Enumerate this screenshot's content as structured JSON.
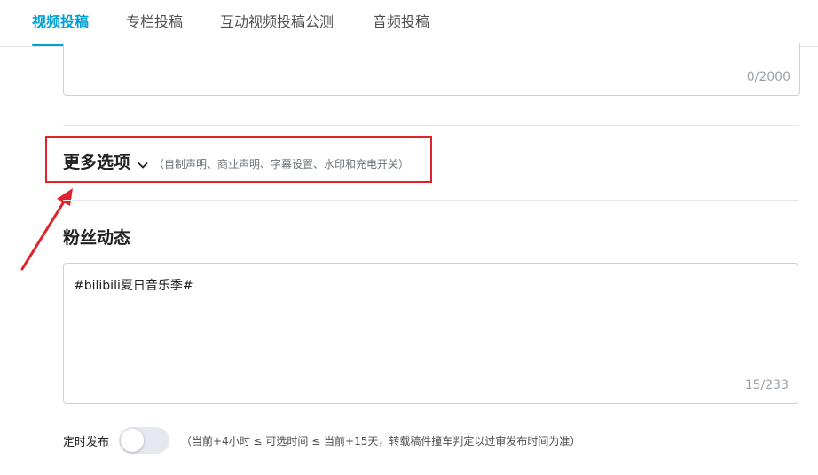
{
  "tabs": [
    {
      "label": "视频投稿",
      "active": true
    },
    {
      "label": "专栏投稿",
      "active": false
    },
    {
      "label": "互动视频投稿公测",
      "active": false
    },
    {
      "label": "音频投稿",
      "active": false
    }
  ],
  "description": {
    "counter": "0/2000"
  },
  "more_options": {
    "title": "更多选项",
    "icon": "chevron-down-icon",
    "hint": "（自制声明、商业声明、字幕设置、水印和充电开关）"
  },
  "fan_dynamics": {
    "title": "粉丝动态",
    "value": "#bilibili夏日音乐季#",
    "counter": "15/233"
  },
  "schedule": {
    "label": "定时发布",
    "enabled": false,
    "hint": "（当前+4小时 ≤ 可选时间 ≤ 当前+15天，转载稿件撞车判定以过审发布时间为准）"
  },
  "colors": {
    "accent": "#00a1d6",
    "annotation": "#e0232a"
  }
}
